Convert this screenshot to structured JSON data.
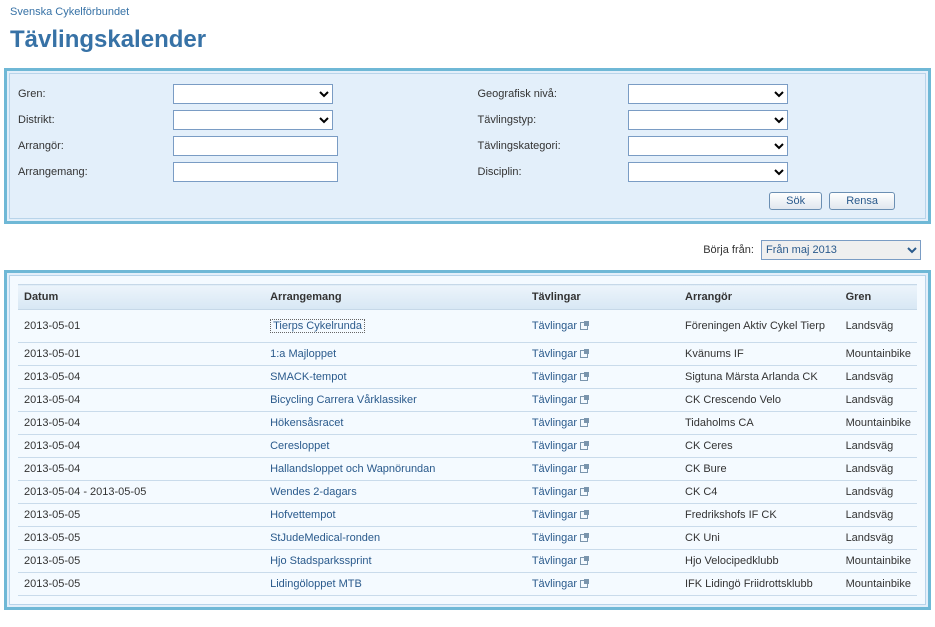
{
  "org_link": "Svenska Cykelförbundet",
  "page_title": "Tävlingskalender",
  "filters": {
    "gren_label": "Gren:",
    "distrikt_label": "Distrikt:",
    "arrangor_label": "Arrangör:",
    "arrangemang_label": "Arrangemang:",
    "geografisk_label": "Geografisk nivå:",
    "tavlingstyp_label": "Tävlingstyp:",
    "tavlingskategori_label": "Tävlingskategori:",
    "disciplin_label": "Disciplin:"
  },
  "buttons": {
    "search": "Sök",
    "clear": "Rensa"
  },
  "start_from": {
    "label": "Börja från:",
    "selected": "Från maj 2013"
  },
  "table": {
    "headers": {
      "datum": "Datum",
      "arrangemang": "Arrangemang",
      "tavlingar": "Tävlingar",
      "arrangor": "Arrangör",
      "gren": "Gren"
    },
    "tavlingar_text": "Tävlingar",
    "rows": [
      {
        "datum": "2013-05-01",
        "arrangemang": "Tierps Cykelrunda",
        "arrangor": "Föreningen Aktiv Cykel Tierp",
        "gren": "Landsväg",
        "highlight": true
      },
      {
        "datum": "2013-05-01",
        "arrangemang": "1:a Majloppet",
        "arrangor": "Kvänums IF",
        "gren": "Mountainbike"
      },
      {
        "datum": "2013-05-04",
        "arrangemang": "SMACK-tempot",
        "arrangor": "Sigtuna Märsta Arlanda CK",
        "gren": "Landsväg"
      },
      {
        "datum": "2013-05-04",
        "arrangemang": "Bicycling Carrera Vårklassiker",
        "arrangor": "CK Crescendo Velo",
        "gren": "Landsväg"
      },
      {
        "datum": "2013-05-04",
        "arrangemang": "Hökensåsracet",
        "arrangor": "Tidaholms CA",
        "gren": "Mountainbike"
      },
      {
        "datum": "2013-05-04",
        "arrangemang": "Ceresloppet",
        "arrangor": "CK Ceres",
        "gren": "Landsväg"
      },
      {
        "datum": "2013-05-04",
        "arrangemang": "Hallandsloppet och Wapnörundan",
        "arrangor": "CK Bure",
        "gren": "Landsväg"
      },
      {
        "datum": "2013-05-04 - 2013-05-05",
        "arrangemang": "Wendes 2-dagars",
        "arrangor": "CK C4",
        "gren": "Landsväg"
      },
      {
        "datum": "2013-05-05",
        "arrangemang": "Hofvettempot",
        "arrangor": "Fredrikshofs IF CK",
        "gren": "Landsväg"
      },
      {
        "datum": "2013-05-05",
        "arrangemang": "StJudeMedical-ronden",
        "arrangor": "CK Uni",
        "gren": "Landsväg"
      },
      {
        "datum": "2013-05-05",
        "arrangemang": "Hjo Stadsparkssprint",
        "arrangor": "Hjo Velocipedklubb",
        "gren": "Mountainbike"
      },
      {
        "datum": "2013-05-05",
        "arrangemang": "Lidingöloppet MTB",
        "arrangor": "IFK Lidingö Friidrottsklubb",
        "gren": "Mountainbike"
      }
    ]
  }
}
